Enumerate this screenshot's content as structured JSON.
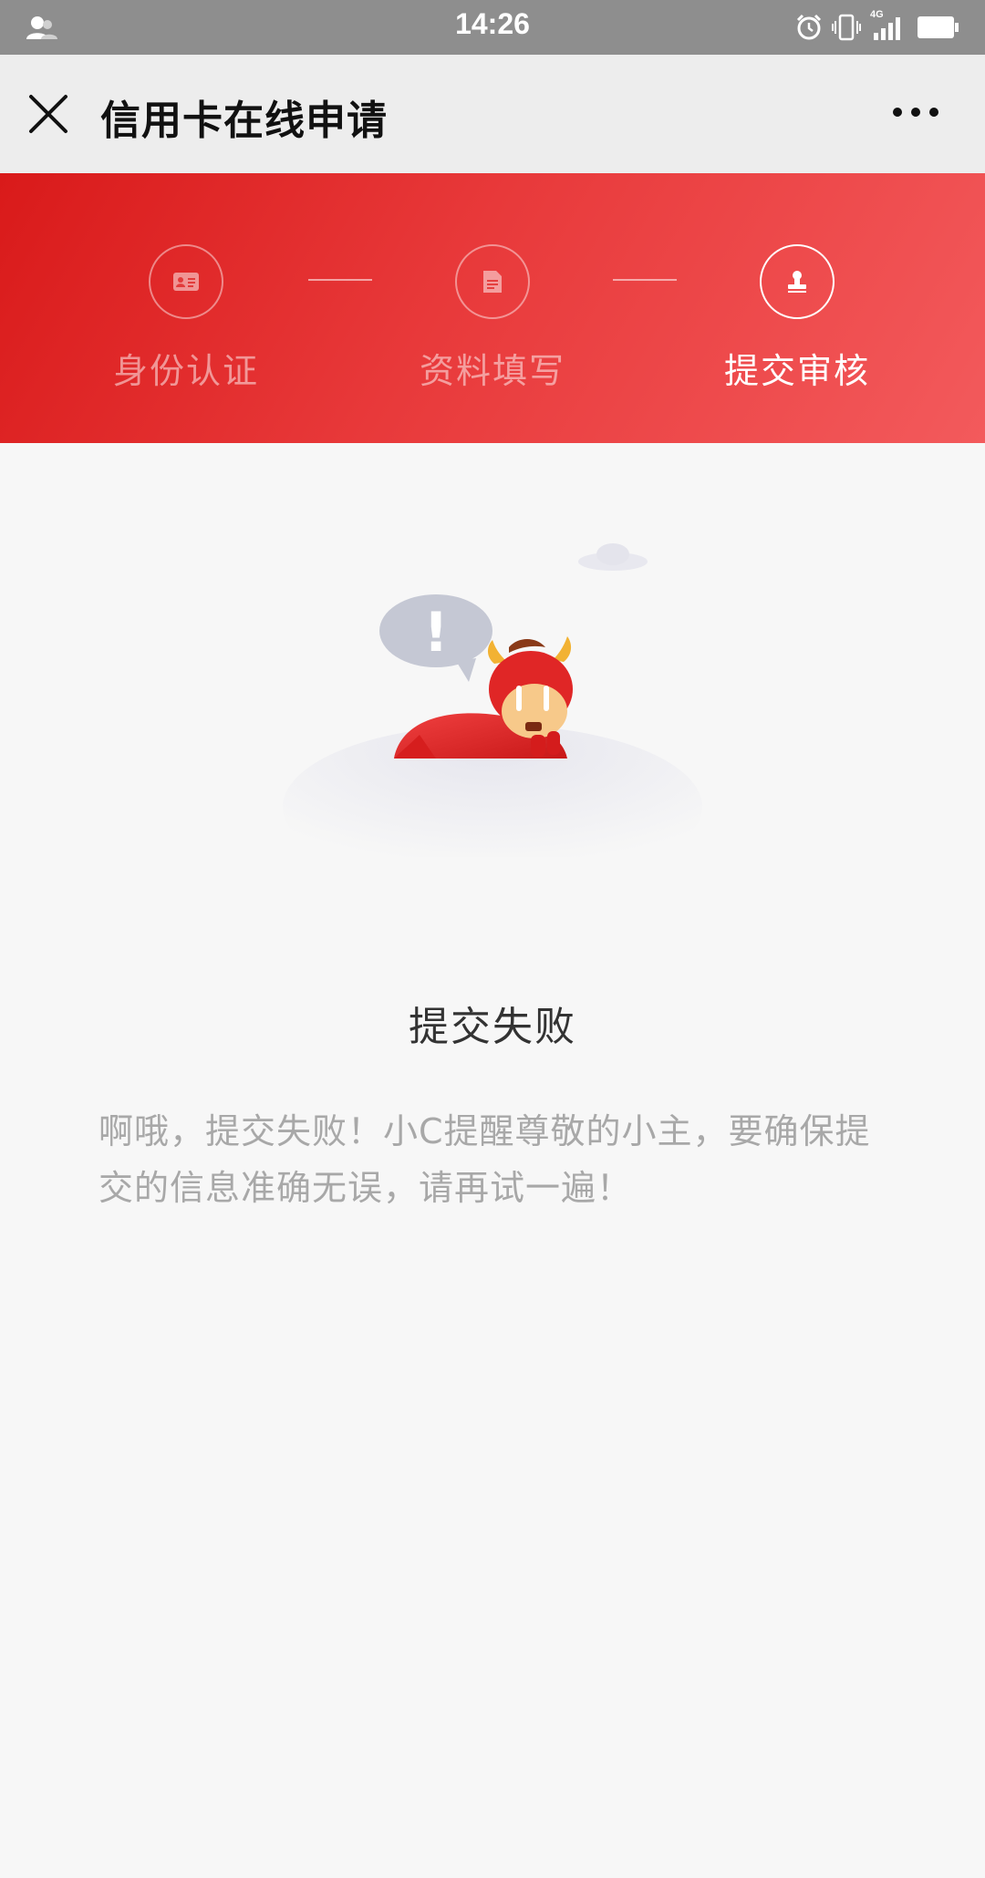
{
  "status_bar": {
    "time": "14:26",
    "network": "4G",
    "icons": [
      "user-icon",
      "alarm-icon",
      "vibrate-icon",
      "signal-icon",
      "battery-icon"
    ]
  },
  "nav": {
    "title": "信用卡在线申请",
    "close_icon": "close-icon",
    "more_icon": "more-icon"
  },
  "steps": [
    {
      "label": "身份认证",
      "icon": "id-card-icon",
      "active": false
    },
    {
      "label": "资料填写",
      "icon": "document-icon",
      "active": false
    },
    {
      "label": "提交审核",
      "icon": "stamp-icon",
      "active": true
    }
  ],
  "illustration": {
    "alert_mark": "!"
  },
  "result": {
    "title": "提交失败",
    "message": "啊哦，提交失败！小C提醒尊敬的小主，要确保提交的信息准确无误，请再试一遍！"
  },
  "colors": {
    "header_gradient_start": "#d91a1a",
    "header_gradient_end": "#f35a5c",
    "status_bar": "#8e8e8e",
    "nav_bar": "#ededed",
    "page_background": "#f7f7f7",
    "title_text": "#333333",
    "message_text": "#a8a8a8"
  }
}
